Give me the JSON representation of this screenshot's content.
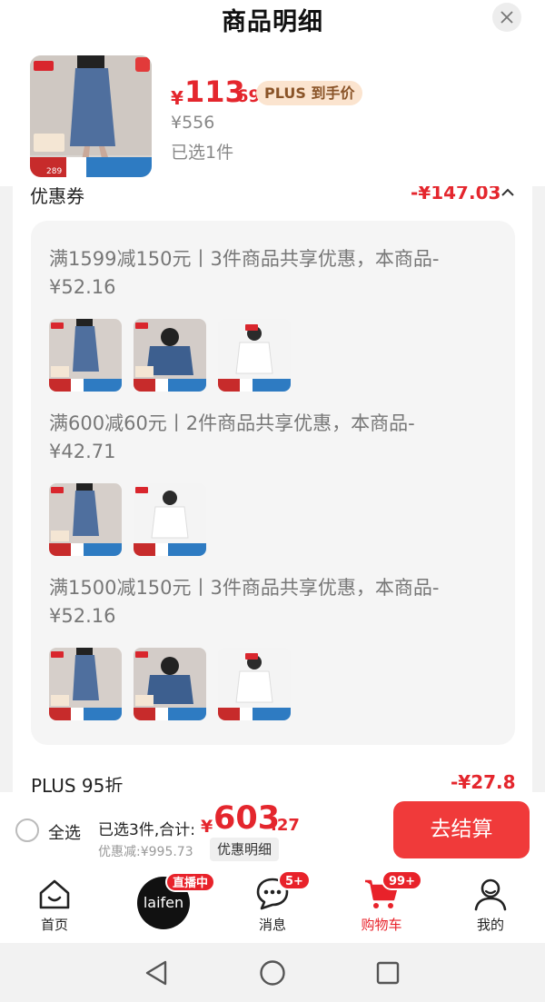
{
  "sheet": {
    "title": "商品明细"
  },
  "product": {
    "price_symbol": "¥",
    "price_int": "113",
    "price_dec": ".69",
    "plus_label": "PLUS 到手价",
    "original_price": "¥556",
    "selected": "已选1件"
  },
  "coupon": {
    "title": "优惠券",
    "amount": "-¥147.03",
    "groups": [
      {
        "text": "满1599减150元丨3件商品共享优惠，本商品-¥52.16"
      },
      {
        "text": "满600减60元丨2件商品共享优惠，本商品-¥42.71"
      },
      {
        "text": "满1500减150元丨3件商品共享优惠，本商品-¥52.16"
      }
    ]
  },
  "plus_discount": {
    "label": "PLUS 95折",
    "amount": "-¥27.8"
  },
  "checkout": {
    "select_all": "全选",
    "summary_label": "已选3件,合计:",
    "total_symbol": "¥",
    "total_int": "603",
    "total_dec": ".27",
    "discount_label": "优惠减:¥995.73",
    "detail_button": "优惠明细",
    "checkout_button": "去结算"
  },
  "tabs": [
    {
      "label": "首页",
      "icon": "home-icon"
    },
    {
      "label": "laifen",
      "icon": "live-logo",
      "badge": "直播中"
    },
    {
      "label": "消息",
      "icon": "message-icon",
      "badge": "5+"
    },
    {
      "label": "购物车",
      "icon": "cart-icon",
      "badge": "99+"
    },
    {
      "label": "我的",
      "icon": "profile-icon"
    }
  ],
  "colors": {
    "accent_red": "#e4262d",
    "active_tab": "#e8222a",
    "plus_badge_bg": "#fbe4cf"
  }
}
